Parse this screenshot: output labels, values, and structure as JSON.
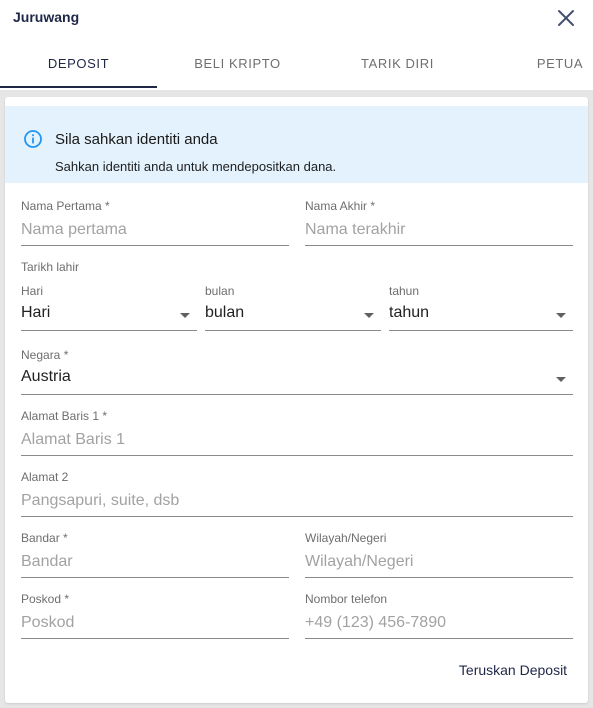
{
  "header": {
    "title": "Juruwang"
  },
  "tabs": [
    {
      "label": "DEPOSIT"
    },
    {
      "label": "BELI KRIPTO"
    },
    {
      "label": "TARIK DIRI"
    },
    {
      "label": "PETUA"
    }
  ],
  "alert": {
    "icon": "info-icon",
    "title": "Sila sahkan identiti anda",
    "text": "Sahkan identiti anda untuk mendepositkan dana.",
    "background_color": "#e3f2fc",
    "icon_color": "#2196f3"
  },
  "form": {
    "first_name": {
      "label": "Nama Pertama  *",
      "placeholder": "Nama pertama"
    },
    "last_name": {
      "label": "Nama Akhir  *",
      "placeholder": "Nama terakhir"
    },
    "dob": {
      "label": "Tarikh lahir",
      "day": {
        "label": "Hari",
        "value": "Hari"
      },
      "month": {
        "label": "bulan",
        "value": "bulan"
      },
      "year": {
        "label": "tahun",
        "value": "tahun"
      }
    },
    "country": {
      "label": "Negara  *",
      "value": "Austria"
    },
    "address1": {
      "label": "Alamat Baris 1  *",
      "placeholder": "Alamat Baris 1"
    },
    "address2": {
      "label": "Alamat 2",
      "placeholder": "Pangsapuri, suite, dsb"
    },
    "city": {
      "label": "Bandar  *",
      "placeholder": "Bandar"
    },
    "state": {
      "label": "Wilayah/Negeri",
      "placeholder": "Wilayah/Negeri"
    },
    "postcode": {
      "label": "Poskod  *",
      "placeholder": "Poskod"
    },
    "phone": {
      "label": "Nombor telefon",
      "placeholder": "+49 (123) 456-7890"
    }
  },
  "actions": {
    "submit_label": "Teruskan Deposit"
  },
  "colors": {
    "primary": "#1f2747",
    "page_background": "#e6e6e6"
  }
}
